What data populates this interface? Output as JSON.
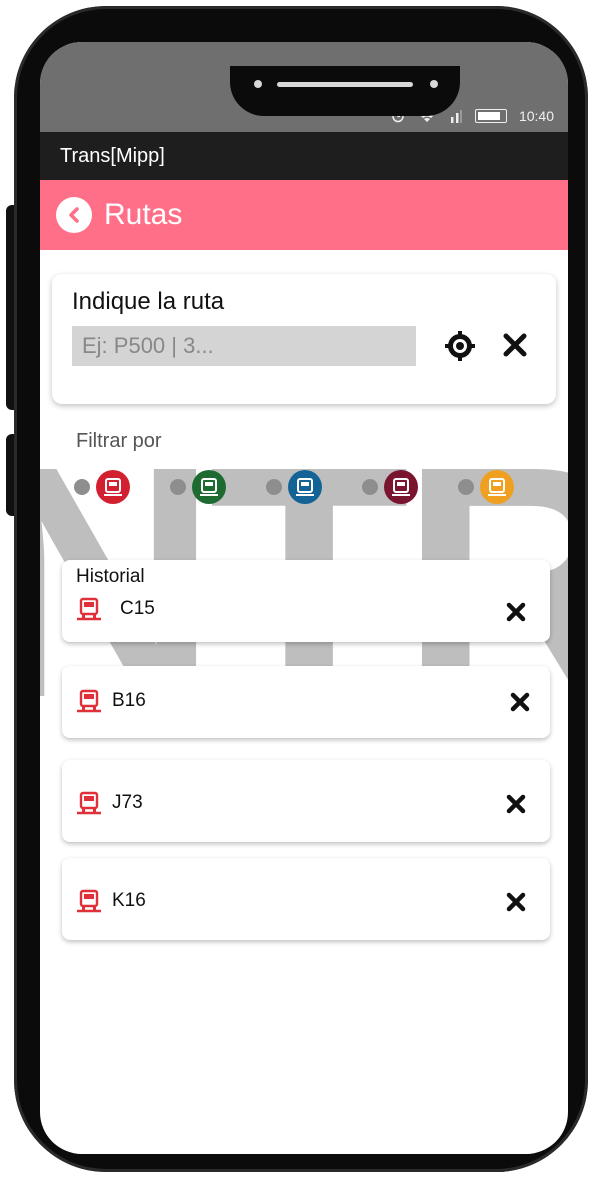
{
  "status_bar": {
    "time": "10:40"
  },
  "app": {
    "title": "Trans[Mipp]"
  },
  "header": {
    "title": "Rutas",
    "back_icon": "chevron-left-icon"
  },
  "search": {
    "label": "Indique la ruta",
    "placeholder": "Ej: P500 | 3...",
    "value": ""
  },
  "filter": {
    "label": "Filtrar por",
    "options": [
      {
        "color": "#d32030",
        "icon": "bus-icon"
      },
      {
        "color": "#1d6b30",
        "icon": "bus-icon"
      },
      {
        "color": "#136397",
        "icon": "bus-icon"
      },
      {
        "color": "#7a1530",
        "icon": "bus-icon"
      },
      {
        "color": "#f0a020",
        "icon": "bus-icon"
      }
    ]
  },
  "history": {
    "title": "Historial",
    "items": [
      {
        "code": "C15"
      },
      {
        "code": "B16"
      },
      {
        "code": "J73"
      },
      {
        "code": "K16"
      }
    ]
  },
  "colors": {
    "accent": "#ff6f87",
    "bus_red": "#e0303a"
  }
}
